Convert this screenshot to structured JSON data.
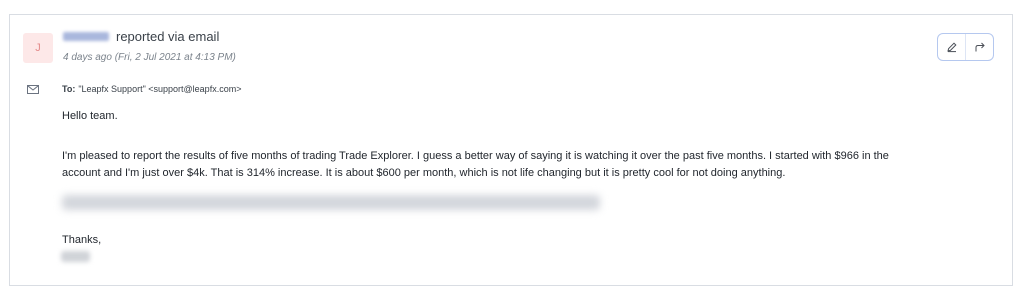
{
  "ticket": {
    "avatar_initial": "J",
    "reported_text": "reported via email",
    "timestamp": "4 days ago (Fri, 2 Jul 2021 at 4:13 PM)",
    "actions": {
      "edit_icon": "pencil-icon",
      "forward_icon": "forward-arrow-icon"
    }
  },
  "email": {
    "envelope_icon": "envelope-icon",
    "to_label": "To:",
    "to_value": "\"Leapfx Support\" <support@leapfx.com>",
    "greeting": "Hello team.",
    "paragraph_line1": "I'm pleased to report the results of five months of trading Trade Explorer.  I guess a better way of saying it is watching it over the past five months.  I started with $966 in the",
    "paragraph_line2": "account and I'm just over $4k.  That is 314% increase.  It is about $600 per month, which is not life changing but it is pretty cool for not doing anything.",
    "signoff": "Thanks,"
  },
  "colors": {
    "accent": "#b5c8ef",
    "avatar_bg": "#fde8e8",
    "avatar_text": "#e48c8c",
    "border": "#d9dde3"
  }
}
